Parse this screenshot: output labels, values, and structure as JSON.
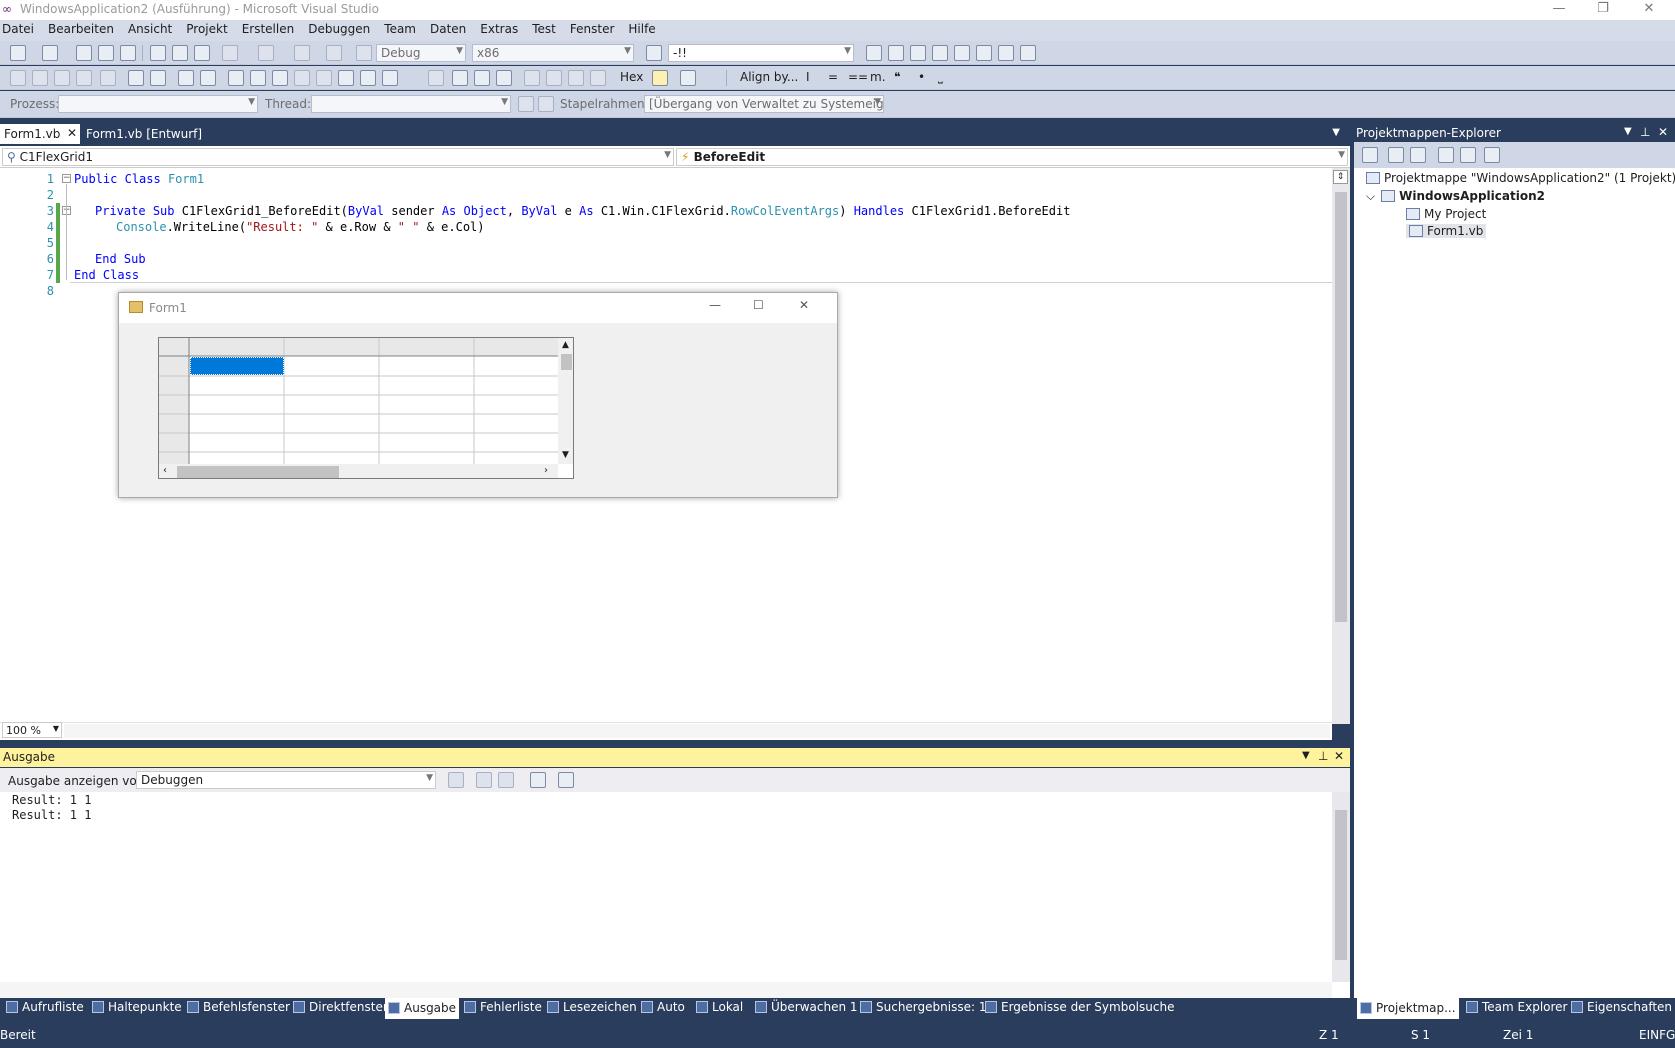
{
  "window": {
    "title": "WindowsApplication2 (Ausführung) - Microsoft Visual Studio"
  },
  "menu": [
    "Datei",
    "Bearbeiten",
    "Ansicht",
    "Projekt",
    "Erstellen",
    "Debuggen",
    "Team",
    "Daten",
    "Extras",
    "Test",
    "Fenster",
    "Hilfe"
  ],
  "toolbar1": {
    "config": "Debug",
    "platform": "x86",
    "find_value": "-!!"
  },
  "toolbar2": {
    "hex": "Hex",
    "align": "Align by..."
  },
  "toolbar3": {
    "process_label": "Prozess:",
    "thread_label": "Thread:",
    "stack_label": "Stapelrahmen:",
    "stack_value": "[Übergang von Verwaltet zu Systemeigen]"
  },
  "tabs": [
    {
      "label": "Form1.vb",
      "active": true
    },
    {
      "label": "Form1.vb [Entwurf]",
      "active": false
    }
  ],
  "nav": {
    "left": "C1FlexGrid1",
    "right": "BeforeEdit"
  },
  "code": {
    "line_numbers": [
      "1",
      "2",
      "3",
      "4",
      "5",
      "6",
      "7",
      "8"
    ],
    "l1": {
      "kw1": "Public",
      "kw2": "Class",
      "name": "Form1"
    },
    "l3": {
      "kw1": "Private",
      "kw2": "Sub",
      "name": "C1FlexGrid1_BeforeEdit(",
      "kw3": "ByVal",
      "p1": " sender ",
      "kw4": "As",
      "kw5": "Object",
      "p2": ", ",
      "kw6": "ByVal",
      "p3": " e ",
      "kw7": "As",
      "p4": " C1.Win.C1FlexGrid.",
      "type": "RowColEventArgs",
      "p5": ") ",
      "kw8": "Handles",
      "p6": " C1FlexGrid1.BeforeEdit"
    },
    "l4": {
      "type": "Console",
      "p1": ".WriteLine(",
      "s1": "\"Result: \"",
      "p2": " & e.Row & ",
      "s2": "\" \"",
      "p3": " & e.Col)"
    },
    "l6": {
      "kw1": "End",
      "kw2": "Sub"
    },
    "l7": {
      "kw1": "End",
      "kw2": "Class"
    }
  },
  "zoom": "100 %",
  "form1": {
    "title": "Form1"
  },
  "output": {
    "title": "Ausgabe",
    "show_from_label": "Ausgabe anzeigen von:",
    "source": "Debuggen",
    "lines": [
      "Result: 1 1",
      "Result: 1 1"
    ]
  },
  "bottom_tabs": [
    "Aufrufliste",
    "Haltepunkte",
    "Befehlsfenster",
    "Direktfenster",
    "Ausgabe",
    "Fehlerliste",
    "Lesezeichen",
    "Auto",
    "Lokal",
    "Überwachen 1",
    "Suchergebnisse: 1",
    "Ergebnisse der Symbolsuche"
  ],
  "solution_tabs": [
    "Projektmap...",
    "Team Explorer",
    "Eigenschaften"
  ],
  "status": {
    "state": "Bereit",
    "line": "Z 1",
    "col": "S 1",
    "char": "Zei 1",
    "mode": "EINFG"
  },
  "solution_explorer": {
    "title": "Projektmappen-Explorer",
    "solution": "Projektmappe \"WindowsApplication2\" (1 Projekt)",
    "project": "WindowsApplication2",
    "items": [
      "My Project",
      "Form1.vb"
    ]
  },
  "colors": {
    "chrome": "#2b3d5c",
    "toolbar": "#cfd6e5",
    "output_header": "#fff29d",
    "selection": "#0078d7"
  }
}
